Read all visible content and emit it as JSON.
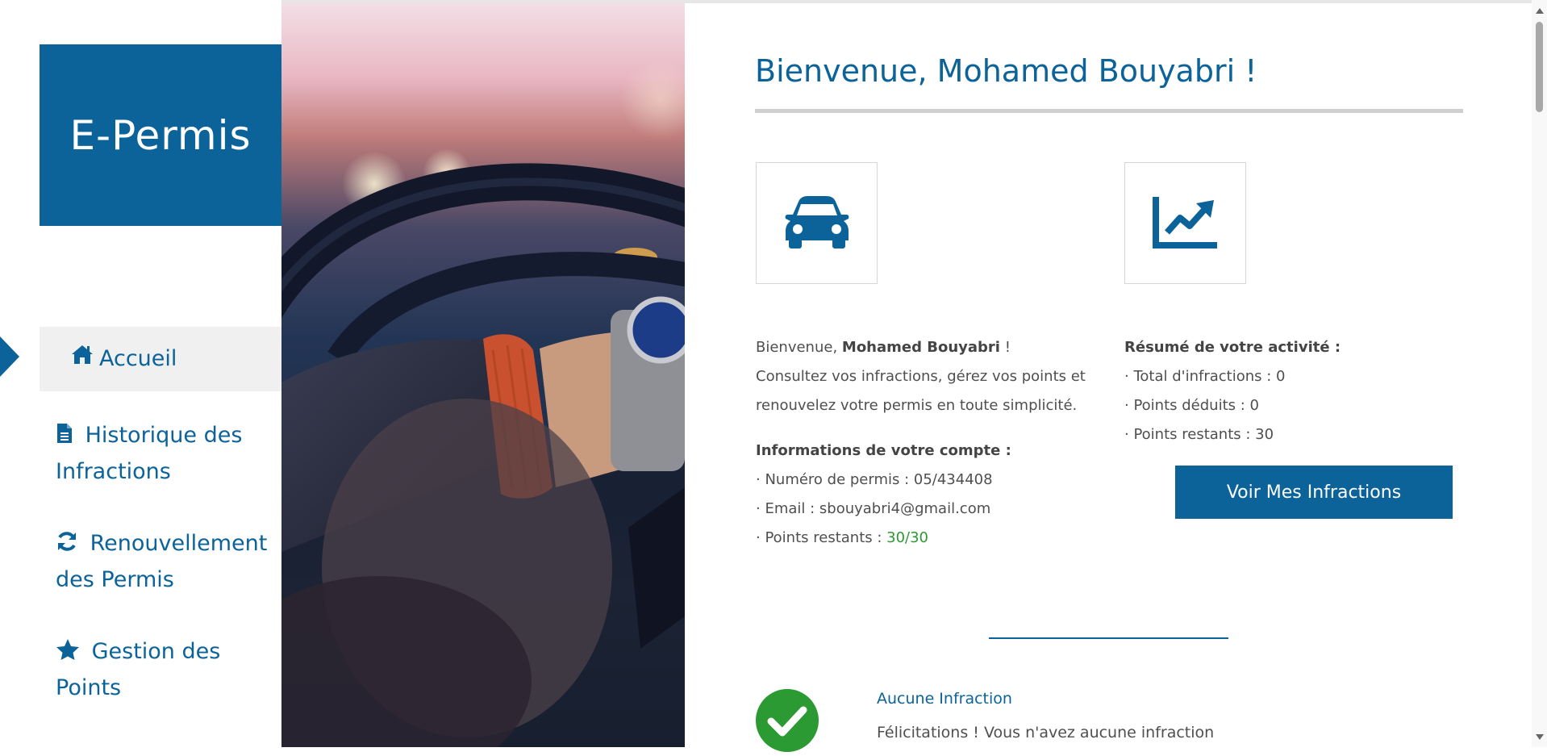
{
  "brand": {
    "title": "E-Permis"
  },
  "nav": {
    "accueil": "Accueil",
    "historique": "Historique des Infractions",
    "renouvellement": "Renouvellement des Permis",
    "gestion": "Gestion des Points"
  },
  "main": {
    "title": "Bienvenue, Mohamed Bouyabri !",
    "intro_prefix": "Bienvenue, ",
    "intro_name": "Mohamed Bouyabri",
    "intro_suffix": " !",
    "intro_text": "Consultez vos infractions, gérez vos points et renouvelez votre permis en toute simplicité.",
    "account": {
      "heading": "Informations de votre compte :",
      "permit_line": "· Numéro de permis : 05/434408",
      "email_line": "· Email : sbouyabri4@gmail.com",
      "points_label": "· Points restants : ",
      "points_value": "30/30"
    },
    "summary": {
      "heading": "Résumé de votre activité :",
      "total_line": "· Total d'infractions : 0",
      "deducted_line": "· Points déduits : 0",
      "remaining_line": "· Points restants : 30"
    },
    "button_label": "Voir Mes Infractions",
    "no_infraction": {
      "title": "Aucune Infraction",
      "text": "Félicitations ! Vous n'avez aucune infraction"
    }
  },
  "icons": {
    "nav": [
      "home-icon",
      "document-icon",
      "refresh-icon",
      "star-icon"
    ],
    "cards": [
      "car-icon",
      "line-chart-icon"
    ],
    "status": "check-circle-icon"
  },
  "colors": {
    "brand": "#0b6399",
    "active_nav_bg": "#f0f0f0",
    "success": "#2b9a32",
    "text": "#4f4f4f"
  }
}
